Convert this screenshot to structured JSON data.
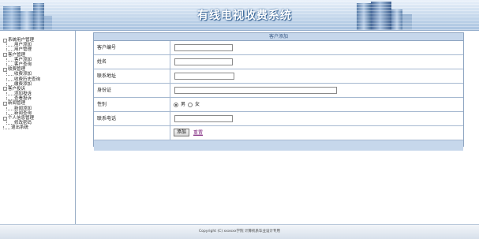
{
  "header": {
    "title": "有线电视收费系统"
  },
  "sidebar": {
    "groups": [
      {
        "label": "系统用户管理",
        "items": [
          "用户添加",
          "用户管理"
        ]
      },
      {
        "label": "客户管理",
        "items": [
          "客户添加",
          "客户查询"
        ]
      },
      {
        "label": "收费管理",
        "items": [
          "收费添加",
          "收费历史查询",
          "缴费添加"
        ]
      },
      {
        "label": "客户投诉",
        "items": [
          "添加投诉",
          "查看投诉"
        ]
      },
      {
        "label": "新闻管理",
        "items": [
          "新闻添加",
          "新闻查询"
        ]
      },
      {
        "label": "个人信息管理",
        "items": [
          "修改密码"
        ]
      }
    ],
    "logout": "退出系统"
  },
  "form": {
    "title": "客户添加",
    "fields": {
      "customer_id": "客户编号",
      "name": "姓名",
      "address": "联系地址",
      "id_card": "身份证",
      "gender": "性别",
      "phone": "联系电话"
    },
    "gender_options": {
      "male": "男",
      "female": "女"
    },
    "add_button": "添加",
    "reset_link": "重置"
  },
  "footer": {
    "copyright": "Copyright (C) xxxxxx学院 计算机系毕业设计专用"
  }
}
